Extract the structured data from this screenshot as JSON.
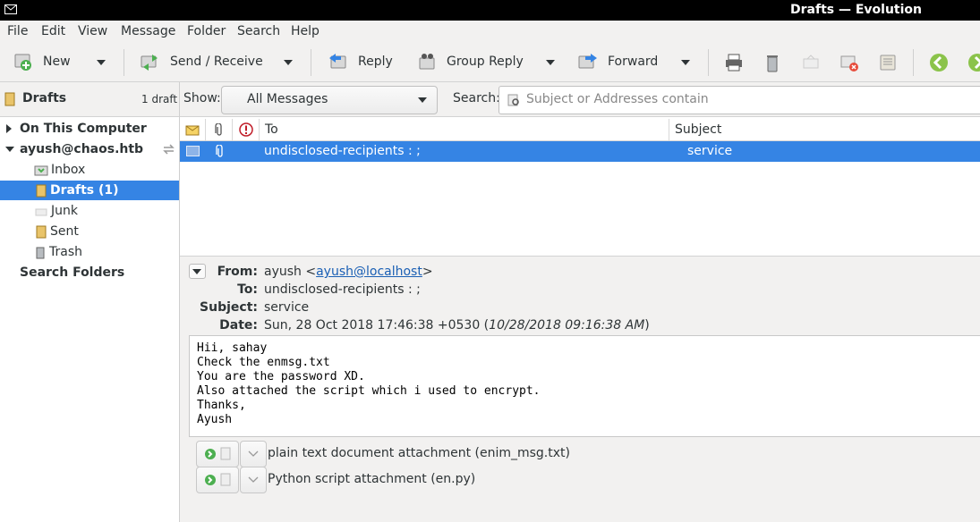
{
  "window": {
    "title": "Drafts — Evolution"
  },
  "menubar": {
    "items": [
      "File",
      "Edit",
      "View",
      "Message",
      "Folder",
      "Search",
      "Help"
    ]
  },
  "toolbar": {
    "new_label": "New",
    "send_receive_label": "Send / Receive",
    "reply_label": "Reply",
    "group_reply_label": "Group Reply",
    "forward_label": "Forward"
  },
  "sidebar": {
    "header_title": "Drafts",
    "header_count": "1 draft",
    "on_this_computer": "On This Computer",
    "account": "ayush@chaos.htb",
    "folders": [
      "Inbox",
      "Drafts (1)",
      "Junk",
      "Sent",
      "Trash"
    ],
    "search_folders": "Search Folders"
  },
  "filter": {
    "show_label": "Show:",
    "show_value": "All Messages",
    "search_label": "Search:",
    "search_placeholder": "Subject or Addresses contain"
  },
  "message_list": {
    "columns": {
      "to": "To",
      "subject": "Subject"
    },
    "rows": [
      {
        "to": "undisclosed-recipients : ;",
        "subject": "service"
      }
    ]
  },
  "preview": {
    "from_label": "From:",
    "from_name": "ayush <",
    "from_email": "ayush@localhost",
    "from_close": ">",
    "to_label": "To:",
    "to_value": "undisclosed-recipients : ;",
    "subject_label": "Subject:",
    "subject_value": "service",
    "date_label": "Date:",
    "date_value": "Sun, 28 Oct 2018 17:46:38 +0530",
    "date_local": "10/28/2018 09:16:38 AM",
    "body": "Hii, sahay\nCheck the enmsg.txt\nYou are the password XD.\nAlso attached the script which i used to encrypt.\nThanks,\nAyush",
    "attachments": [
      "plain text document attachment (enim_msg.txt)",
      "Python script attachment (en.py)"
    ]
  },
  "colors": {
    "selection": "#3584e4",
    "link": "#1a5fb4"
  }
}
